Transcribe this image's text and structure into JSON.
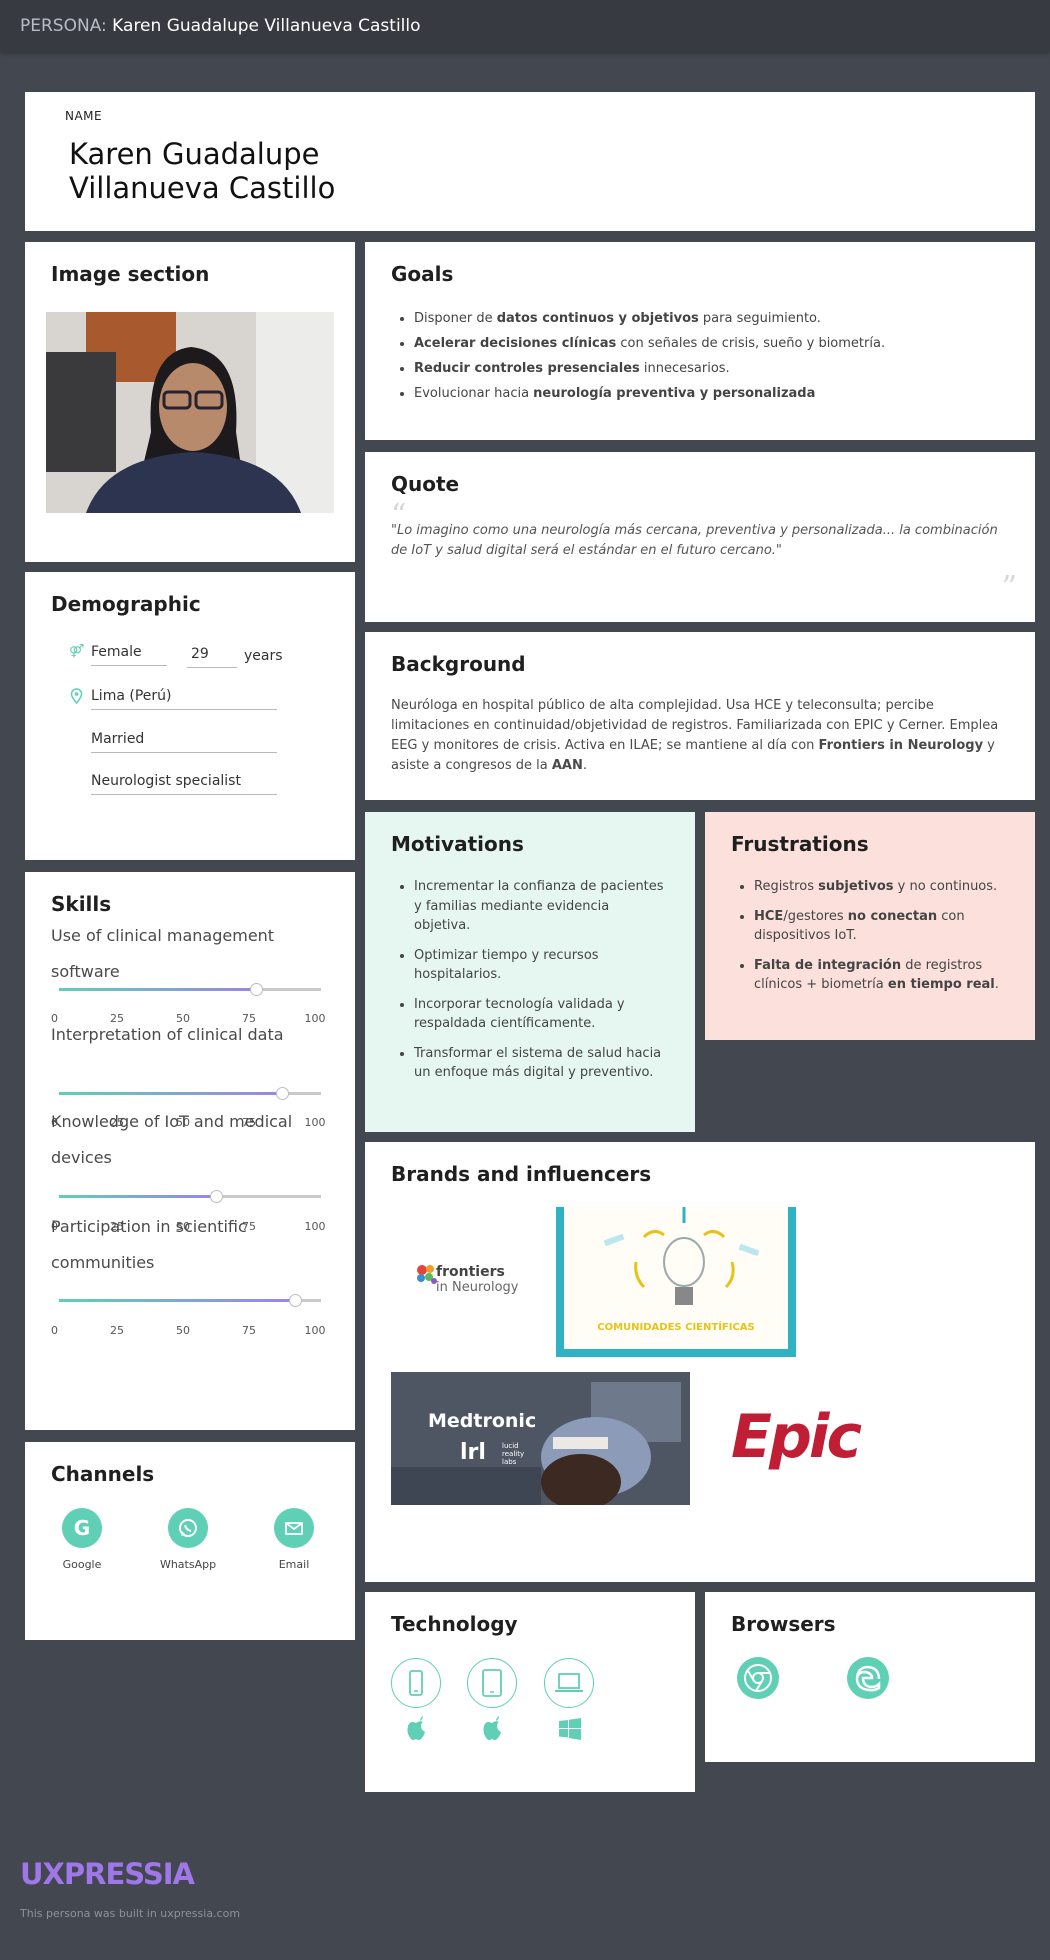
{
  "header": {
    "prefix": "PERSONA:",
    "name": "Karen Guadalupe Villanueva Castillo"
  },
  "name_card": {
    "label": "NAME",
    "line1": "Karen Guadalupe",
    "line2": "Villanueva Castillo"
  },
  "image_section": {
    "title": "Image section"
  },
  "demographic": {
    "title": "Demographic",
    "gender": "Female",
    "age": "29",
    "age_unit": "years",
    "location": "Lima (Perú)",
    "marital": "Married",
    "occupation": "Neurologist specialist"
  },
  "skills": {
    "title": "Skills",
    "ticks": [
      "0",
      "25",
      "50",
      "75",
      "100"
    ],
    "items": [
      {
        "label": "Use of clinical management software",
        "value": 75
      },
      {
        "label": "Interpretation of clinical data",
        "value": 85
      },
      {
        "label": "Knowledge of IoT and medical devices",
        "value": 60
      },
      {
        "label": "Participation in scientific communities",
        "value": 90
      }
    ]
  },
  "channels": {
    "title": "Channels",
    "items": [
      {
        "label": "Google",
        "icon": "google-icon"
      },
      {
        "label": "WhatsApp",
        "icon": "whatsapp-icon"
      },
      {
        "label": "Email",
        "icon": "email-icon"
      }
    ]
  },
  "goals": {
    "title": "Goals",
    "items": [
      {
        "a": "Disponer de ",
        "b": "datos continuos y objetivos",
        "c": " para seguimiento."
      },
      {
        "a": "",
        "b": "Acelerar decisiones clínicas",
        "c": " con señales de crisis, sueño y biometría."
      },
      {
        "a": "",
        "b": "Reducir controles presenciales",
        "c": " innecesarios."
      },
      {
        "a": "Evolucionar hacia ",
        "b": "neurología preventiva y personalizada",
        "c": ""
      }
    ]
  },
  "quote": {
    "title": "Quote",
    "text": "\"Lo imagino como una neurología más cercana, preventiva y personalizada... la combinación de IoT y salud digital será el estándar en el futuro cercano.\""
  },
  "background": {
    "title": "Background",
    "t1": "Neuróloga en hospital público de alta complejidad. Usa HCE y teleconsulta; percibe limitaciones en continuidad/objetividad de registros. Familiarizada con EPIC y Cerner. Emplea EEG y monitores de crisis. Activa en ILAE; se mantiene al día con ",
    "b1": "Frontiers in Neurology",
    "t2": " y asiste a congresos de la ",
    "b2": "AAN",
    "t3": "."
  },
  "motivations": {
    "title": "Motivations",
    "items": [
      "Incrementar la confianza de pacientes y familias mediante evidencia objetiva.",
      "Optimizar tiempo y recursos hospitalarios.",
      "Incorporar tecnología validada y respaldada científicamente.",
      "Transformar el sistema de salud hacia un enfoque más digital y preventivo."
    ]
  },
  "frustrations": {
    "title": "Frustrations",
    "items": [
      {
        "a": "Registros ",
        "b": "subjetivos",
        "c": " y no continuos.",
        "d": "",
        "e": ""
      },
      {
        "a": "",
        "b": "HCE",
        "c": "/gestores ",
        "d": "no conectan",
        "e": " con dispositivos IoT."
      },
      {
        "a": "",
        "b": "Falta de integración",
        "c": " de registros clínicos + biometría ",
        "d": "en tiempo real",
        "e": "."
      }
    ]
  },
  "brands": {
    "title": "Brands and influencers",
    "frontiers_a": "frontiers",
    "frontiers_b": "in Neurology",
    "comunidades": "COMUNIDADES CIENTÍFICAS",
    "medtronic": "Medtronic",
    "lucid_a": "lucid",
    "lucid_b": "reality",
    "lucid_c": "labs",
    "epic": "Epic"
  },
  "technology": {
    "title": "Technology",
    "devices": [
      "smartphone-icon",
      "tablet-icon",
      "laptop-icon"
    ],
    "os": [
      "apple-icon",
      "apple-icon",
      "windows-icon"
    ]
  },
  "browsers": {
    "title": "Browsers",
    "items": [
      "chrome-icon",
      "edge-icon"
    ]
  },
  "footer": {
    "logo": "UXPRESSIA",
    "note": "This persona was built in uxpressia.com"
  },
  "colors": {
    "accent": "#5fd0b5",
    "purple": "#9f77e8",
    "motivations_bg": "#e6f7f2",
    "frustrations_bg": "#fbe0dc",
    "page_bg": "#434750"
  }
}
